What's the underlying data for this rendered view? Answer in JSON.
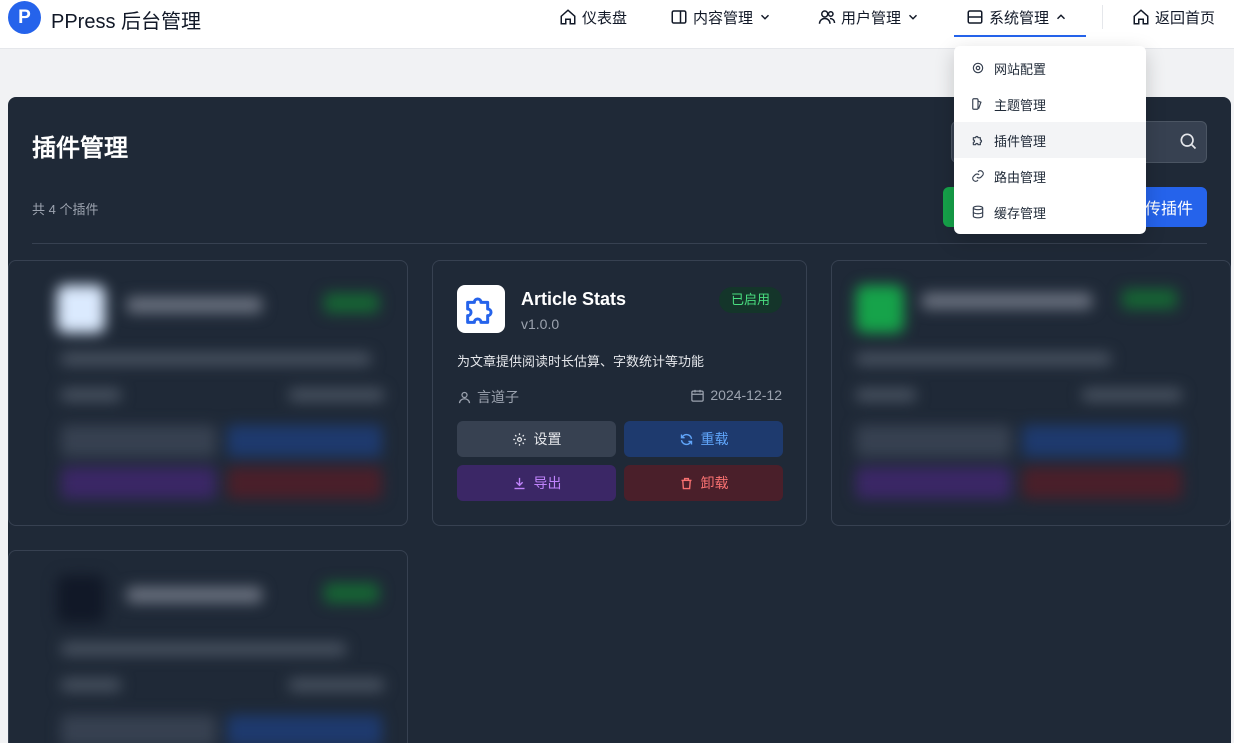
{
  "brand": {
    "logo_letter": "P",
    "title": "PPress 后台管理"
  },
  "nav": {
    "dashboard": "仪表盘",
    "content": "内容管理",
    "users": "用户管理",
    "system": "系统管理",
    "home": "返回首页"
  },
  "system_menu": [
    {
      "label": "网站配置",
      "icon": "gear-icon"
    },
    {
      "label": "主题管理",
      "icon": "palette-icon"
    },
    {
      "label": "插件管理",
      "icon": "puzzle-icon"
    },
    {
      "label": "路由管理",
      "icon": "link-icon"
    },
    {
      "label": "缓存管理",
      "icon": "database-icon"
    }
  ],
  "page": {
    "title": "插件管理",
    "count": "共 4 个插件",
    "upload_button": "传插件"
  },
  "plugin": {
    "name": "Article Stats",
    "version": "v1.0.0",
    "status": "已启用",
    "description": "为文章提供阅读时长估算、字数统计等功能",
    "author": "言道子",
    "date": "2024-12-12",
    "actions": {
      "settings": "设置",
      "reload": "重载",
      "export": "导出",
      "uninstall": "卸载"
    }
  },
  "colors": {
    "accent": "#2563eb",
    "panel": "#1f2937",
    "enabled_green": "#4ade80"
  }
}
